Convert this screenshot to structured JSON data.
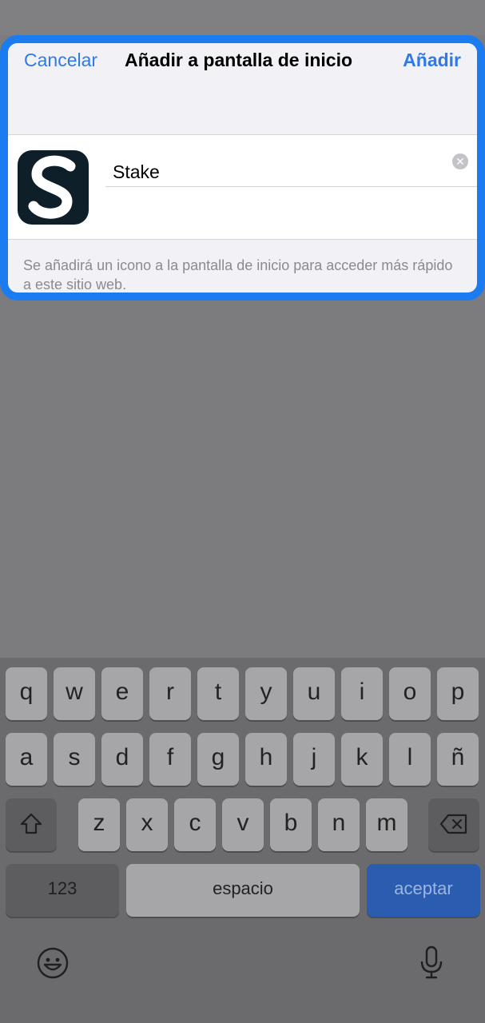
{
  "sheet": {
    "cancel_label": "Cancelar",
    "title": "Añadir a pantalla de inicio",
    "add_label": "Añadir",
    "name_value": "Stake",
    "hint_text": "Se añadirá un icono a la pantalla de inicio para acceder más rápido a este sitio web.",
    "icon": "stake-s-logo-icon",
    "clear_icon": "clear-x-icon"
  },
  "keyboard": {
    "row1": [
      "q",
      "w",
      "e",
      "r",
      "t",
      "y",
      "u",
      "i",
      "o",
      "p"
    ],
    "row2": [
      "a",
      "s",
      "d",
      "f",
      "g",
      "h",
      "j",
      "k",
      "l",
      "ñ"
    ],
    "row3": [
      "z",
      "x",
      "c",
      "v",
      "b",
      "n",
      "m"
    ],
    "numbers_label": "123",
    "space_label": "espacio",
    "accept_label": "aceptar",
    "shift_icon": "shift-icon",
    "delete_icon": "backspace-icon",
    "emoji_icon": "emoji-icon",
    "mic_icon": "microphone-icon"
  },
  "colors": {
    "accent": "#2f7ae8",
    "sheet_border": "#1a7cf0",
    "accept_key": "#2a5cb0"
  }
}
